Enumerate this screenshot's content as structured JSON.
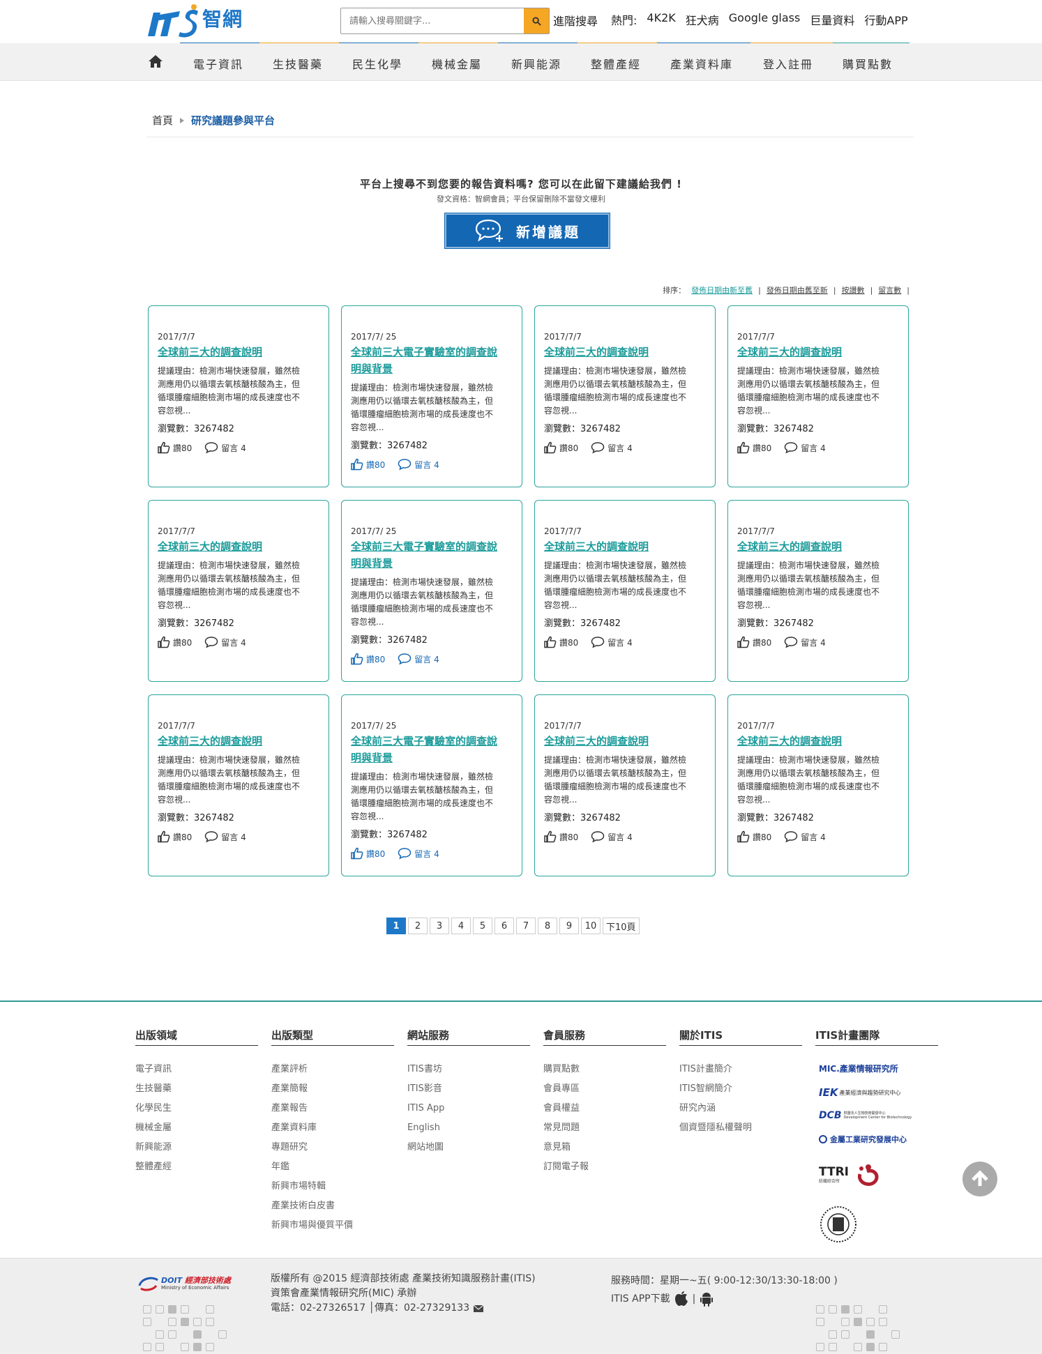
{
  "header": {
    "logo_text": "智網",
    "search_placeholder": "請輸入搜尋關鍵字...",
    "advanced_search": "進階搜尋",
    "hot_label": "熱門:",
    "hot_items": [
      "4K2K",
      "狂犬病",
      "Google glass",
      "巨量資料",
      "行動APP"
    ]
  },
  "nav": [
    "電子資訊",
    "生技醫藥",
    "民生化學",
    "機械金屬",
    "新興能源",
    "整體產經",
    "產業資料庫",
    "登入註冊",
    "購買點數"
  ],
  "breadcrumb": {
    "home": "首頁",
    "current": "研究議題參與平台"
  },
  "prompt": {
    "title": "平台上搜尋不到您要的報告資料嗎? 您可以在此留下建議給我們 !",
    "subtitle": "發文資格：智網會員；平台保留刪除不當發文權利",
    "add_button": "新增議題"
  },
  "sort": {
    "label": "排序：",
    "options": [
      "發佈日期由新至舊",
      "發佈日期由舊至新",
      "按讚數",
      "留言數"
    ]
  },
  "cards": [
    {
      "date": "2017/7/7",
      "title_lines": [
        "全球前三大的調查說明"
      ],
      "desc": [
        "提議理由：檢測市場快速發展，雖然檢",
        "測應用仍以循環去氧核醣核酸為主，但",
        "循環腫瘤細胞檢測市場的成長速度也不",
        "容忽視..."
      ],
      "views": "瀏覽數：3267482",
      "likes": "讚80",
      "comments": "留言 4",
      "style": "plain"
    },
    {
      "date": "2017/7/ 25",
      "title_lines": [
        "全球前三大電子實驗室的調查說",
        "明與背景"
      ],
      "desc": [
        "提議理由：檢測市場快速發展，雖然檢",
        "測應用仍以循環去氧核醣核酸為主，但",
        "循環腫瘤細胞檢測市場的成長速度也不",
        "容忽視..."
      ],
      "views": "瀏覽數：3267482",
      "likes": "讚80",
      "comments": "留言 4",
      "style": "blue"
    },
    {
      "date": "2017/7/7",
      "title_lines": [
        "全球前三大的調查說明"
      ],
      "desc": [
        "提議理由：檢測市場快速發展，雖然檢",
        "測應用仍以循環去氧核醣核酸為主，但",
        "循環腫瘤細胞檢測市場的成長速度也不",
        "容忽視..."
      ],
      "views": "瀏覽數：3267482",
      "likes": "讚80",
      "comments": "留言 4",
      "style": "plain"
    },
    {
      "date": "2017/7/7",
      "title_lines": [
        "全球前三大的調查說明"
      ],
      "desc": [
        "提議理由：檢測市場快速發展，雖然檢",
        "測應用仍以循環去氧核醣核酸為主，但",
        "循環腫瘤細胞檢測市場的成長速度也不",
        "容忽視..."
      ],
      "views": "瀏覽數：3267482",
      "likes": "讚80",
      "comments": "留言 4",
      "style": "plain"
    },
    {
      "date": "2017/7/7",
      "title_lines": [
        "全球前三大的調查說明"
      ],
      "desc": [
        "提議理由：檢測市場快速發展，雖然檢",
        "測應用仍以循環去氧核醣核酸為主，但",
        "循環腫瘤細胞檢測市場的成長速度也不",
        "容忽視..."
      ],
      "views": "瀏覽數：3267482",
      "likes": "讚80",
      "comments": "留言 4",
      "style": "plain"
    },
    {
      "date": "2017/7/ 25",
      "title_lines": [
        "全球前三大電子實驗室的調查說",
        "明與背景"
      ],
      "desc": [
        "提議理由：檢測市場快速發展，雖然檢",
        "測應用仍以循環去氧核醣核酸為主，但",
        "循環腫瘤細胞檢測市場的成長速度也不",
        "容忽視..."
      ],
      "views": "瀏覽數：3267482",
      "likes": "讚80",
      "comments": "留言 4",
      "style": "blue"
    },
    {
      "date": "2017/7/7",
      "title_lines": [
        "全球前三大的調查說明"
      ],
      "desc": [
        "提議理由：檢測市場快速發展，雖然檢",
        "測應用仍以循環去氧核醣核酸為主，但",
        "循環腫瘤細胞檢測市場的成長速度也不",
        "容忽視..."
      ],
      "views": "瀏覽數：3267482",
      "likes": "讚80",
      "comments": "留言 4",
      "style": "plain"
    },
    {
      "date": "2017/7/7",
      "title_lines": [
        "全球前三大的調查說明"
      ],
      "desc": [
        "提議理由：檢測市場快速發展，雖然檢",
        "測應用仍以循環去氧核醣核酸為主，但",
        "循環腫瘤細胞檢測市場的成長速度也不",
        "容忽視..."
      ],
      "views": "瀏覽數：3267482",
      "likes": "讚80",
      "comments": "留言 4",
      "style": "plain"
    },
    {
      "date": "2017/7/7",
      "title_lines": [
        "全球前三大的調查說明"
      ],
      "desc": [
        "提議理由：檢測市場快速發展，雖然檢",
        "測應用仍以循環去氧核醣核酸為主，但",
        "循環腫瘤細胞檢測市場的成長速度也不",
        "容忽視..."
      ],
      "views": "瀏覽數：3267482",
      "likes": "讚80",
      "comments": "留言 4",
      "style": "plain"
    },
    {
      "date": "2017/7/ 25",
      "title_lines": [
        "全球前三大電子實驗室的調查說",
        "明與背景"
      ],
      "desc": [
        "提議理由：檢測市場快速發展，雖然檢",
        "測應用仍以循環去氧核醣核酸為主，但",
        "循環腫瘤細胞檢測市場的成長速度也不",
        "容忽視..."
      ],
      "views": "瀏覽數：3267482",
      "likes": "讚80",
      "comments": "留言 4",
      "style": "blue"
    },
    {
      "date": "2017/7/7",
      "title_lines": [
        "全球前三大的調查說明"
      ],
      "desc": [
        "提議理由：檢測市場快速發展，雖然檢",
        "測應用仍以循環去氧核醣核酸為主，但",
        "循環腫瘤細胞檢測市場的成長速度也不",
        "容忽視..."
      ],
      "views": "瀏覽數：3267482",
      "likes": "讚80",
      "comments": "留言 4",
      "style": "plain"
    },
    {
      "date": "2017/7/7",
      "title_lines": [
        "全球前三大的調查說明"
      ],
      "desc": [
        "提議理由：檢測市場快速發展，雖然檢",
        "測應用仍以循環去氧核醣核酸為主，但",
        "循環腫瘤細胞檢測市場的成長速度也不",
        "容忽視..."
      ],
      "views": "瀏覽數：3267482",
      "likes": "讚80",
      "comments": "留言 4",
      "style": "plain"
    }
  ],
  "pagination": [
    "1",
    "2",
    "3",
    "4",
    "5",
    "6",
    "7",
    "8",
    "9",
    "10",
    "下10頁"
  ],
  "footer": {
    "columns": [
      {
        "title": "出版領域",
        "items": [
          "電子資訊",
          "生技醫藥",
          "化學民生",
          "機械金屬",
          "新興能源",
          "整體產經"
        ]
      },
      {
        "title": "出版類型",
        "items": [
          "產業評析",
          "產業簡報",
          "產業報告",
          "產業資料庫",
          "專題研究",
          "年鑑",
          "新興市場特輯",
          "產業技術白皮書",
          "新興市場與優質平價"
        ]
      },
      {
        "title": "網站服務",
        "items": [
          "ITIS書坊",
          "ITIS影音",
          "ITIS App",
          "English",
          "網站地圖"
        ]
      },
      {
        "title": "會員服務",
        "items": [
          "購買點數",
          "會員專區",
          "會員權益",
          "常見問題",
          "意見箱",
          "訂閱電子報"
        ]
      },
      {
        "title": "關於ITIS",
        "items": [
          "ITIS計畫簡介",
          "ITIS智網簡介",
          "研究內涵",
          "個資暨隱私權聲明"
        ]
      },
      {
        "title": "ITIS計畫團隊",
        "items": []
      }
    ],
    "team": {
      "mic": "MIC.產業情報研究所",
      "iek": "產業經濟與趨勢研究中心",
      "dcb": "財團法人生物技術開發中心",
      "dcb_en": "Development Center for Biotechnology",
      "mirdc": "金屬工業研究發展中心",
      "ttri": "TTRI",
      "ttri_cn": "紡織綜合所"
    },
    "doit_cn": "經濟部技術處",
    "doit_en": "Ministry of Economic Affairs",
    "copyright": [
      "版權所有 @2015 經濟部技術處 產業技術知識服務計畫(ITIS)",
      "資策會產業情報研究所(MIC) 承辦",
      "電話：02-27326517 │傳真：02-27329133"
    ],
    "service_hours": "服務時間：星期一~五( 9:00-12:30/13:30-18:00 )",
    "app_download": "ITIS APP下載"
  },
  "colors": {
    "primary": "#1467b3",
    "teal": "#2aa59b",
    "orange": "#f5a623"
  }
}
